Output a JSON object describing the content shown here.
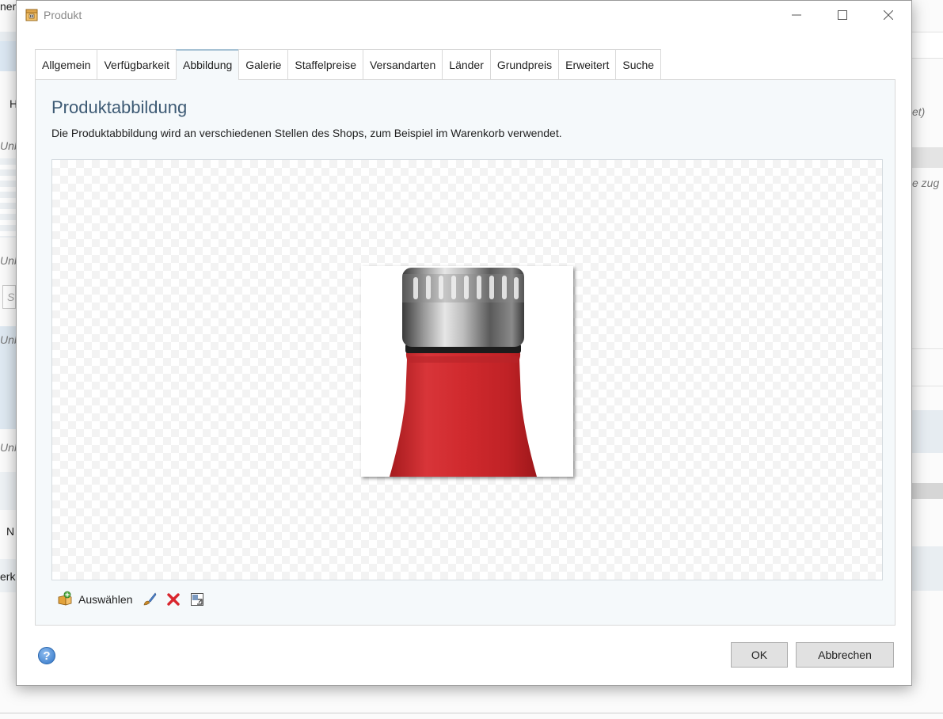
{
  "background": {
    "texts": [
      "ner",
      "H",
      "Unb",
      "Unb",
      "Unb",
      "Unb",
      "N",
      "erko",
      "et)",
      "e zug",
      "S"
    ]
  },
  "window": {
    "title": "Produkt",
    "icon": "product-box-icon",
    "controls": [
      "minimize-icon",
      "maximize-icon",
      "close-icon"
    ]
  },
  "tabs": [
    {
      "label": "Allgemein",
      "active": false
    },
    {
      "label": "Verfügbarkeit",
      "active": false
    },
    {
      "label": "Abbildung",
      "active": true
    },
    {
      "label": "Galerie",
      "active": false
    },
    {
      "label": "Staffelpreise",
      "active": false
    },
    {
      "label": "Versandarten",
      "active": false
    },
    {
      "label": "Länder",
      "active": false
    },
    {
      "label": "Grundpreis",
      "active": false
    },
    {
      "label": "Erweitert",
      "active": false
    },
    {
      "label": "Suche",
      "active": false
    }
  ],
  "panel": {
    "title": "Produktabbildung",
    "description": "Die Produktabbildung wird an verschiedenen Stellen des Shops, zum Beispiel im Warenkorb verwendet."
  },
  "image_toolbar": {
    "select_label": "Auswählen",
    "icons": [
      "select-image-icon",
      "edit-brush-icon",
      "delete-icon",
      "image-properties-icon"
    ]
  },
  "footer": {
    "ok_label": "OK",
    "cancel_label": "Abbrechen"
  },
  "colors": {
    "title_accent": "#3d5a74",
    "active_tab_border": "#a7c2d4",
    "bottle_red": "#d0292c",
    "delete_red": "#d9262e"
  }
}
